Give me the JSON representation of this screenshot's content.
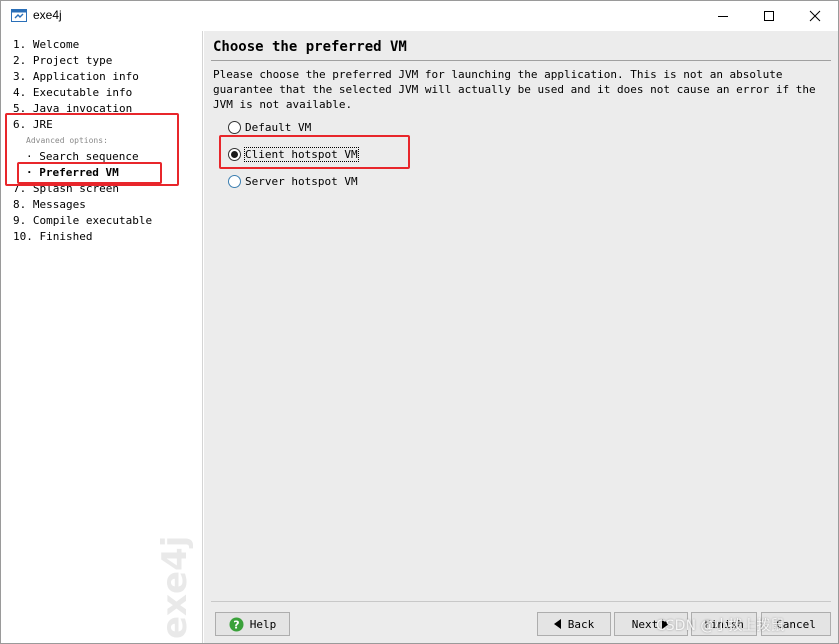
{
  "window": {
    "title": "exe4j",
    "icon": "exe4j-app-icon",
    "controls": [
      "minimize-icon",
      "maximize-icon",
      "close-icon"
    ]
  },
  "sidebar": {
    "steps": [
      {
        "num": "1.",
        "label": "Welcome"
      },
      {
        "num": "2.",
        "label": "Project type"
      },
      {
        "num": "3.",
        "label": "Application info"
      },
      {
        "num": "4.",
        "label": "Executable info"
      },
      {
        "num": "5.",
        "label": "Java invocation"
      },
      {
        "num": "6.",
        "label": "JRE"
      },
      {
        "num": "7.",
        "label": "Splash screen"
      },
      {
        "num": "8.",
        "label": "Messages"
      },
      {
        "num": "9.",
        "label": "Compile executable"
      },
      {
        "num": "10.",
        "label": "Finished"
      }
    ],
    "advanced_label": "Advanced options:",
    "sub_items": [
      {
        "label": "· Search sequence",
        "selected": false
      },
      {
        "label": "· Preferred VM",
        "selected": true
      }
    ],
    "brand": "exe4j"
  },
  "main": {
    "title": "Choose the preferred VM",
    "description": "Please choose the preferred JVM for launching the application. This is not an absolute guarantee that the selected JVM will actually be used and it does not cause an error if the JVM is not available.",
    "options": [
      {
        "label": "Default VM",
        "checked": false
      },
      {
        "label": "Client hotspot VM",
        "checked": true
      },
      {
        "label": "Server hotspot VM",
        "checked": false
      }
    ]
  },
  "buttons": {
    "help": "Help",
    "back": "Back",
    "next": "Next",
    "finish": "Finish",
    "cancel": "Cancel"
  },
  "watermark": "CSDN @小拨上拨鼠",
  "colors": {
    "annotation": "#e8262b",
    "panel": "#ececec",
    "help_icon": "#3aa13a"
  }
}
